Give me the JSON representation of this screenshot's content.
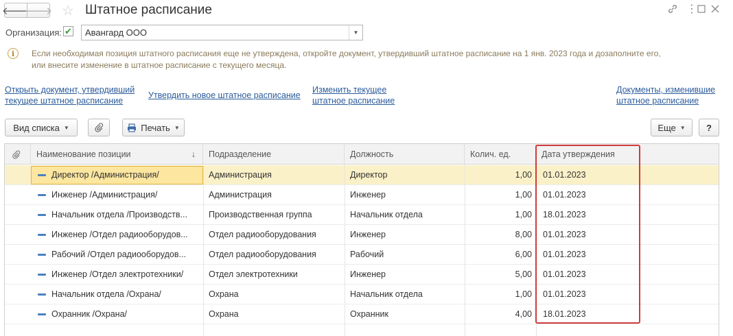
{
  "window": {
    "title": "Штатное расписание",
    "back_icon": "arrow-left-icon",
    "forward_icon": "arrow-right-icon",
    "favorite_icon": "star-icon",
    "link_icon": "link-icon",
    "menu_icon": "more-icon",
    "maximize_icon": "maximize-icon",
    "close_icon": "close-icon"
  },
  "org": {
    "label": "Организация:",
    "value": "Авангард ООО",
    "checked": true
  },
  "info": {
    "text_line1": "Если необходимая позиция штатного расписания еще не утверждена, откройте документ, утвердивший штатное расписание на 1 янв. 2023 года и дозаполните его,",
    "text_line2": "или внесите изменение в штатное расписание с текущего месяца."
  },
  "links": {
    "open_doc_line1": "Открыть документ, утвердивший",
    "open_doc_line2": "текущее штатное расписание",
    "approve_new": "Утвердить новое штатное расписание",
    "change_current_line1": "Изменить текущее",
    "change_current_line2": "штатное расписание",
    "docs_changed_line1": "Документы, изменившие",
    "docs_changed_line2": "штатное расписание"
  },
  "toolbar": {
    "view_list": "Вид списка",
    "print": "Печать",
    "more": "Еще",
    "help": "?"
  },
  "table": {
    "columns": {
      "name": "Наименование позиции",
      "sort_indicator": "↓",
      "department": "Подразделение",
      "position": "Должность",
      "units": "Колич. ед.",
      "date": "Дата утверждения"
    },
    "rows": [
      {
        "name": "Директор /Администрация/",
        "department": "Администрация",
        "position": "Директор",
        "units": "1,00",
        "date": "01.01.2023"
      },
      {
        "name": "Инженер /Администрация/",
        "department": "Администрация",
        "position": "Инженер",
        "units": "1,00",
        "date": "01.01.2023"
      },
      {
        "name": "Начальник отдела /Производств...",
        "department": "Производственная группа",
        "position": "Начальник отдела",
        "units": "1,00",
        "date": "18.01.2023"
      },
      {
        "name": "Инженер /Отдел радиооборудов...",
        "department": "Отдел радиооборудования",
        "position": "Инженер",
        "units": "8,00",
        "date": "01.01.2023"
      },
      {
        "name": "Рабочий /Отдел радиооборудов...",
        "department": "Отдел радиооборудования",
        "position": "Рабочий",
        "units": "6,00",
        "date": "01.01.2023"
      },
      {
        "name": "Инженер /Отдел электротехники/",
        "department": "Отдел электротехники",
        "position": "Инженер",
        "units": "5,00",
        "date": "01.01.2023"
      },
      {
        "name": "Начальник отдела /Охрана/",
        "department": "Охрана",
        "position": "Начальник отдела",
        "units": "1,00",
        "date": "01.01.2023"
      },
      {
        "name": "Охранник /Охрана/",
        "department": "Охрана",
        "position": "Охранник",
        "units": "4,00",
        "date": "18.01.2023"
      }
    ],
    "selected_row": 0
  },
  "colors": {
    "selected_row": "#fbf1c8",
    "highlight_border": "#cf3b3b",
    "link": "#2a5b9b"
  }
}
